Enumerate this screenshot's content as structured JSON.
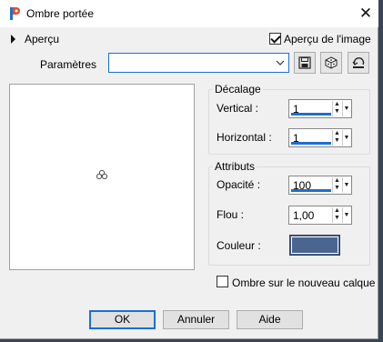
{
  "window": {
    "title": "Ombre portée",
    "close_glyph": "✕"
  },
  "preview_section": {
    "label": "Aperçu",
    "image_preview_label": "Aperçu de l'image",
    "image_preview_checked": true
  },
  "params": {
    "label": "Paramètres",
    "value": "",
    "icons": [
      "save-preset-icon",
      "randomize-icon",
      "reset-icon"
    ]
  },
  "offset": {
    "group_title": "Décalage",
    "vertical_label": "Vertical :",
    "vertical_value": "1",
    "horizontal_label": "Horizontal :",
    "horizontal_value": "1"
  },
  "attributes": {
    "group_title": "Attributs",
    "opacity_label": "Opacité :",
    "opacity_value": "100",
    "blur_label": "Flou :",
    "blur_value": "1,00",
    "color_label": "Couleur :",
    "color_hex": "#4a6590"
  },
  "new_layer": {
    "label": "Ombre sur le nouveau calque",
    "checked": false
  },
  "buttons": {
    "ok": "OK",
    "cancel": "Annuler",
    "help": "Aide"
  },
  "colors": {
    "accent": "#1a6fd4",
    "window_bg": "#f0f0f0"
  }
}
